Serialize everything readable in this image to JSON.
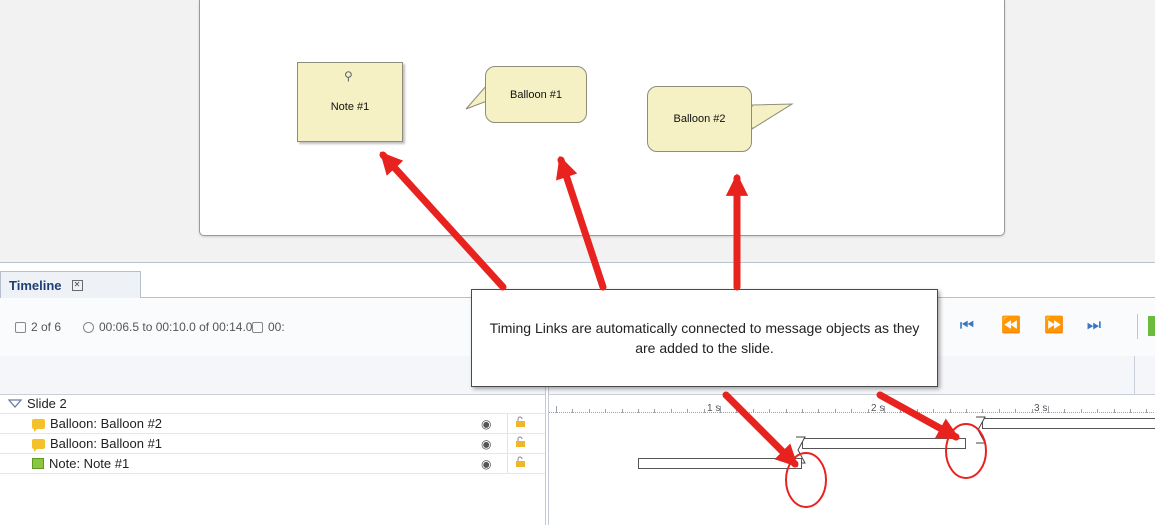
{
  "canvas": {
    "note_1": "Note #1",
    "balloon_1": "Balloon #1",
    "balloon_2": "Balloon #2"
  },
  "timeline": {
    "tab_label": "Timeline",
    "slide_count": "2 of 6",
    "time_range": "00:06.5 to 00:10.0 of 00:14.0",
    "duration_partial": "00:",
    "ruler": [
      "1 s",
      "2 s",
      "3 s"
    ],
    "rows": [
      {
        "label": "Slide 2",
        "type": "slide"
      },
      {
        "label": "Balloon: Balloon #2",
        "type": "balloon",
        "bar_start_s": 2.6,
        "bar_end_s": 3.7
      },
      {
        "label": "Balloon: Balloon #1",
        "type": "balloon",
        "bar_start_s": 1.5,
        "bar_end_s": 2.5
      },
      {
        "label": "Note: Note #1",
        "type": "note",
        "bar_start_s": 0.5,
        "bar_end_s": 1.5
      }
    ]
  },
  "callout": {
    "text": "Timing Links are automatically connected to message objects as they are added to the slide."
  },
  "colors": {
    "arrow": "#e8231f",
    "object_fill": "#f5f1c5",
    "tab_text": "#1d3f74",
    "nav_icon": "#3a76c4"
  }
}
